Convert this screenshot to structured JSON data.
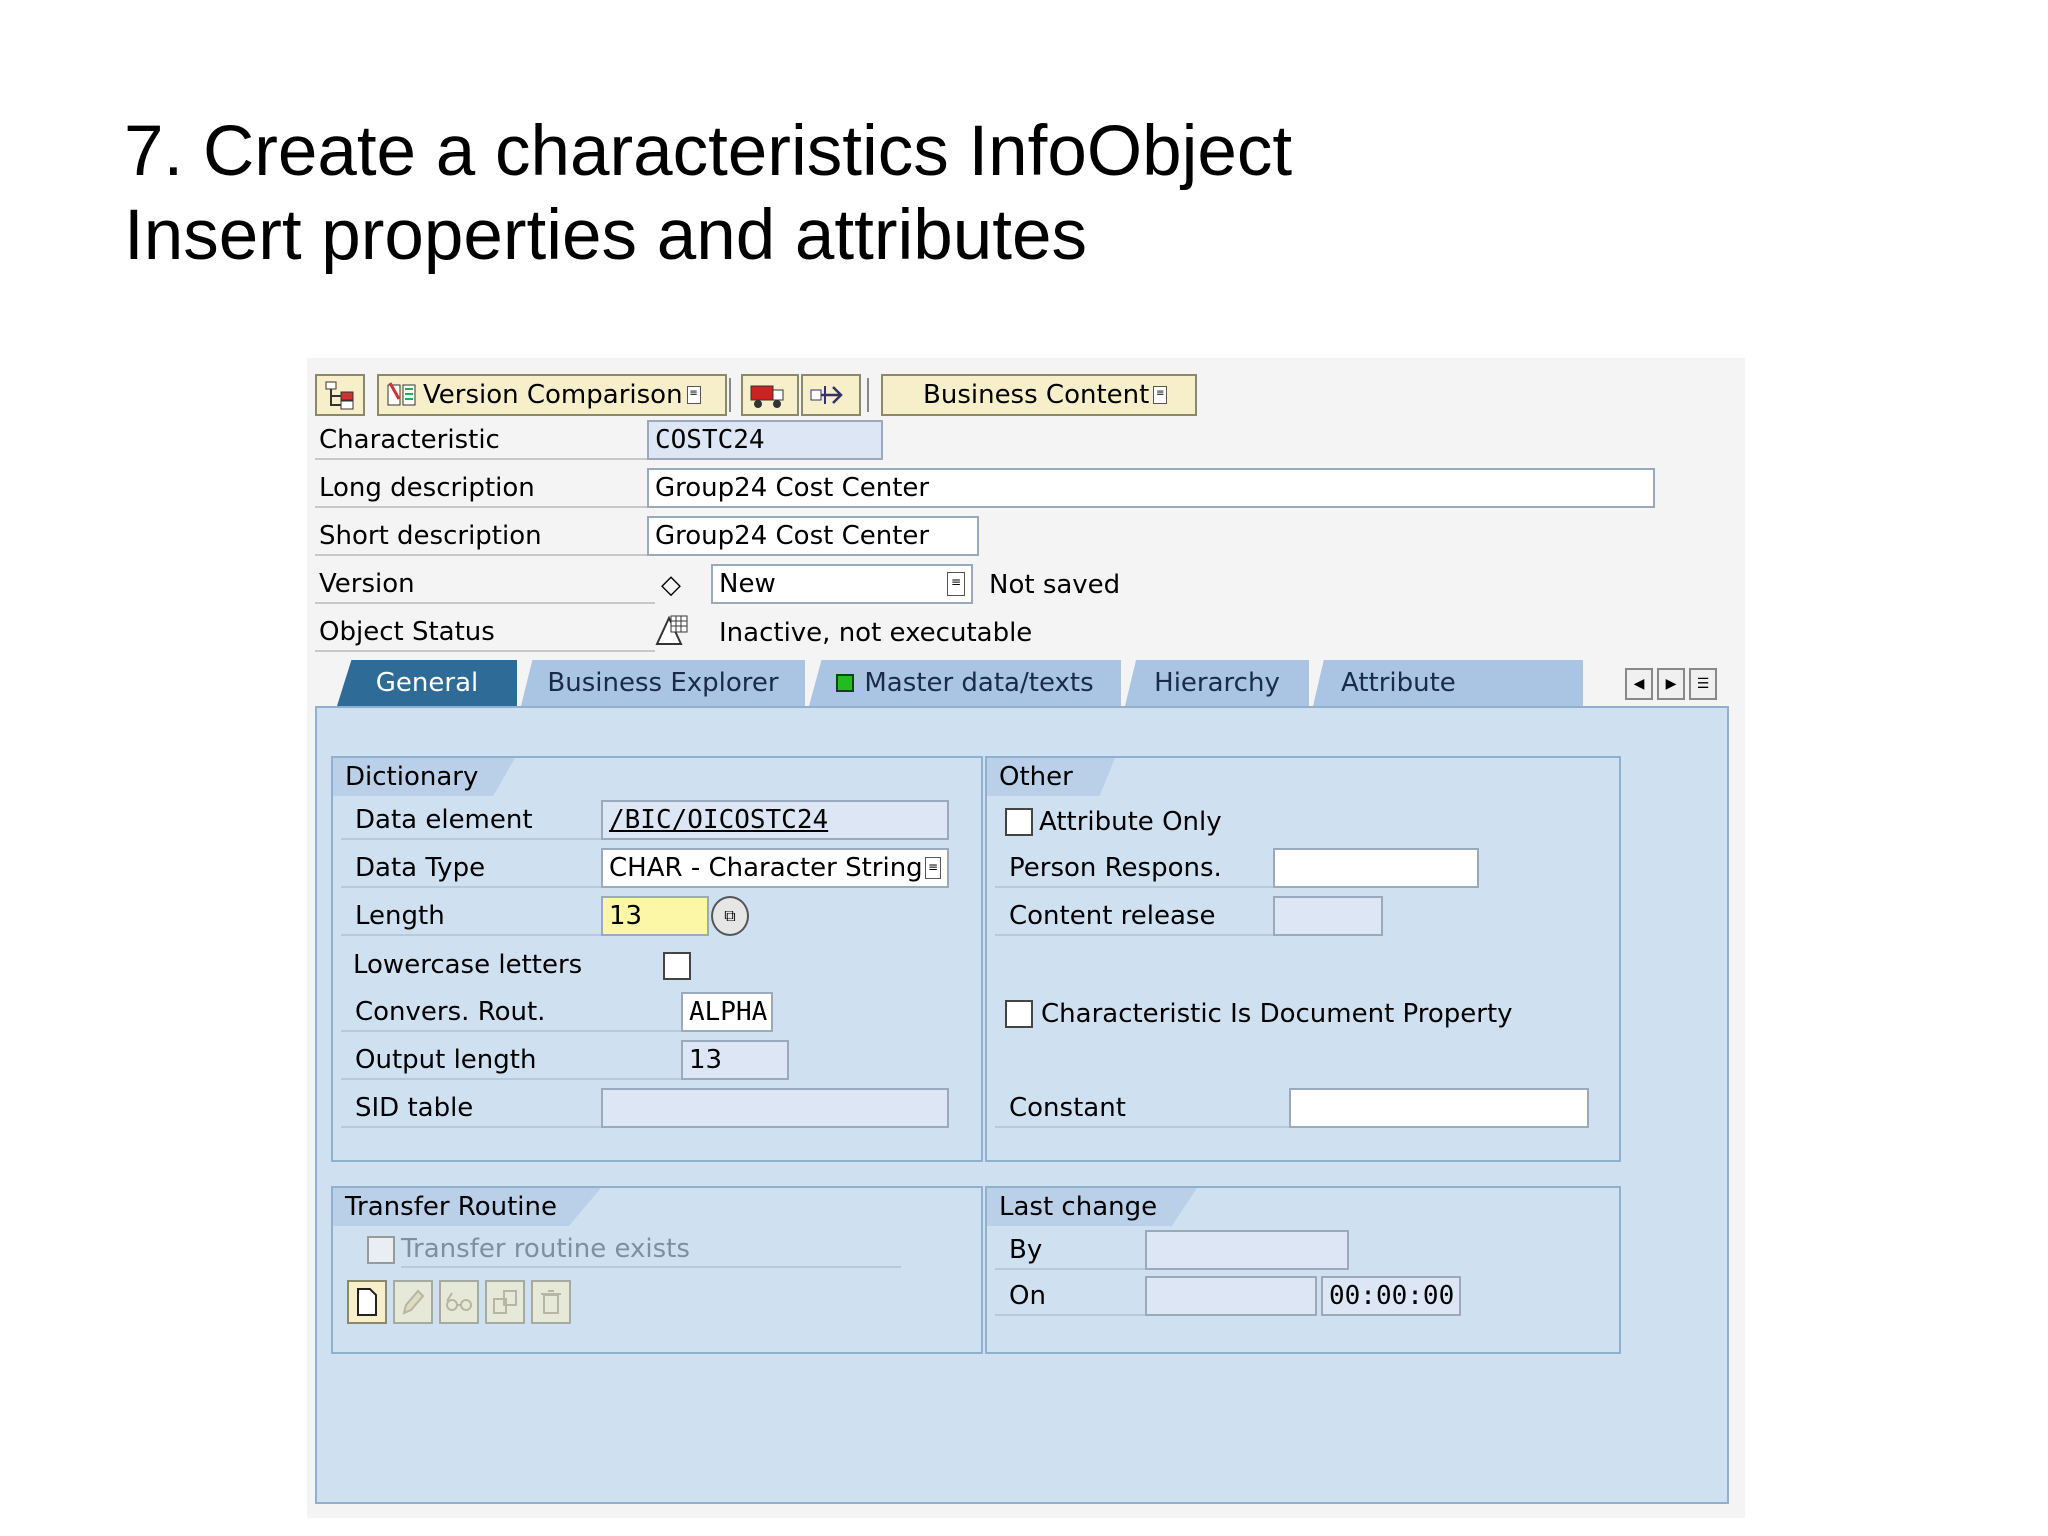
{
  "slide": {
    "title_line1": "7. Create a characteristics InfoObject",
    "title_line2": "Insert properties and attributes"
  },
  "toolbar": {
    "version_comparison": "Version Comparison",
    "business_content": "Business Content"
  },
  "header": {
    "characteristic_label": "Characteristic",
    "characteristic_value": "COSTC24",
    "long_desc_label": "Long description",
    "long_desc_value": "Group24 Cost Center",
    "short_desc_label": "Short description",
    "short_desc_value": "Group24 Cost Center",
    "version_label": "Version",
    "version_value": "New",
    "version_status": "Not saved",
    "object_status_label": "Object Status",
    "object_status_value": "Inactive, not executable"
  },
  "tabs": [
    {
      "label": "General",
      "active": true
    },
    {
      "label": "Business Explorer"
    },
    {
      "label": "Master data/texts"
    },
    {
      "label": "Hierarchy"
    },
    {
      "label": "Attribute"
    }
  ],
  "dictionary": {
    "title": "Dictionary",
    "data_element_label": "Data element",
    "data_element_value": "/BIC/OICOSTC24",
    "data_type_label": "Data Type",
    "data_type_value": "CHAR - Character String",
    "length_label": "Length",
    "length_value": "13",
    "lowercase_label": "Lowercase letters",
    "convers_label": "Convers. Rout.",
    "convers_value": "ALPHA",
    "output_length_label": "Output length",
    "output_length_value": "13",
    "sid_table_label": "SID table",
    "sid_table_value": ""
  },
  "other": {
    "title": "Other",
    "attribute_only_label": "Attribute Only",
    "person_respons_label": "Person Respons.",
    "content_release_label": "Content release",
    "doc_property_label": "Characteristic Is Document Property",
    "constant_label": "Constant"
  },
  "transfer": {
    "title": "Transfer Routine",
    "exists_label": "Transfer routine exists"
  },
  "last_change": {
    "title": "Last change",
    "by_label": "By",
    "on_label": "On",
    "time_value": "00:00:00"
  },
  "colors": {
    "panel": "#cfe0f0",
    "active_tab": "#2f6b97",
    "tab": "#a9c5e3",
    "button": "#f7efc9",
    "status_green": "#22bb22"
  }
}
